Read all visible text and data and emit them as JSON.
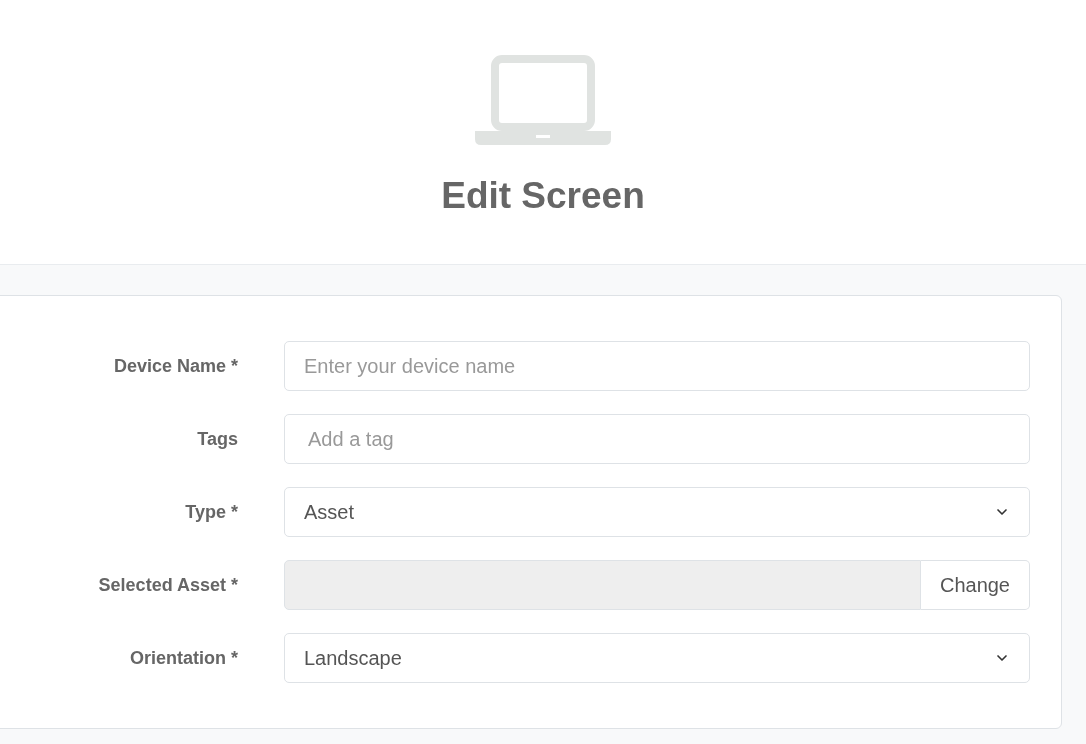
{
  "header": {
    "title": "Edit Screen"
  },
  "fields": [
    {
      "label": "Device Name *",
      "kind": "text",
      "placeholder": "Enter your device name"
    },
    {
      "label": "Tags",
      "kind": "tags",
      "placeholder": "Add a tag"
    },
    {
      "label": "Type *",
      "kind": "select",
      "value": "Asset"
    },
    {
      "label": "Selected Asset *",
      "kind": "picker",
      "button": "Change"
    },
    {
      "label": "Orientation *",
      "kind": "select",
      "value": "Landscape"
    }
  ]
}
